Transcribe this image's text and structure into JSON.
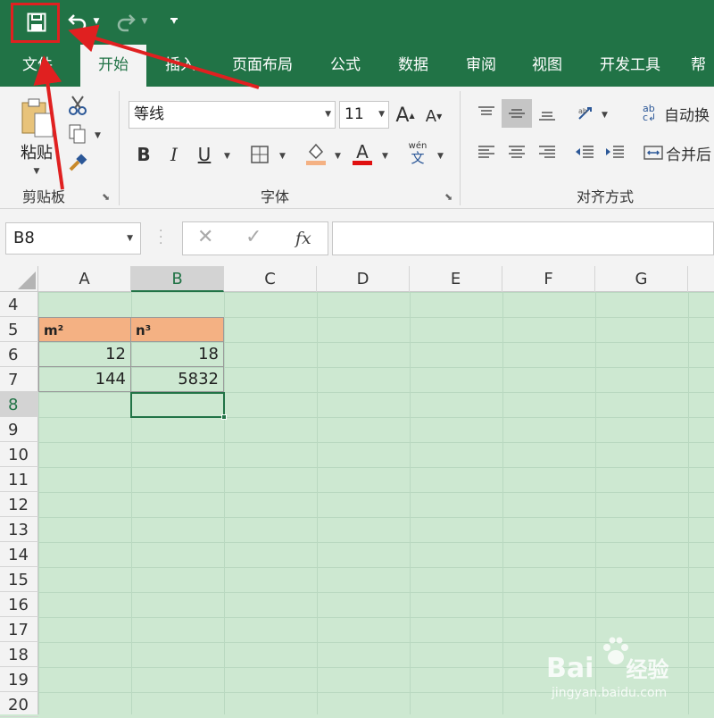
{
  "quick_access": {
    "save_icon": "save-icon",
    "undo_icon": "undo-icon",
    "redo_icon": "redo-icon",
    "customize_icon": "customize-qat-icon"
  },
  "tabs": [
    "文件",
    "开始",
    "插入",
    "页面布局",
    "公式",
    "数据",
    "审阅",
    "视图",
    "开发工具",
    "帮"
  ],
  "active_tab": "开始",
  "clipboard": {
    "paste_label": "粘贴",
    "group_label": "剪贴板"
  },
  "font": {
    "name": "等线",
    "size": "11",
    "group_label": "字体",
    "bold": "B",
    "italic": "I",
    "underline": "U",
    "phonetic_top": "wén",
    "phonetic_bottom": "文",
    "grow": "A",
    "shrink": "A",
    "font_color_letter": "A"
  },
  "alignment": {
    "wrap_text": "自动换",
    "merge_center": "合并后",
    "group_label": "对齐方式"
  },
  "formula_bar": {
    "name_box": "B8",
    "fx": "fx",
    "value": ""
  },
  "columns": [
    "A",
    "B",
    "C",
    "D",
    "E",
    "F",
    "G"
  ],
  "selected_column": "B",
  "rows": [
    "4",
    "5",
    "6",
    "7",
    "8",
    "9",
    "10",
    "11",
    "12",
    "13",
    "14",
    "15",
    "16",
    "17",
    "18",
    "19",
    "20"
  ],
  "selected_row": "8",
  "cells": {
    "A5": "m²",
    "B5": "n³",
    "A6": "12",
    "B6": "18",
    "A7": "144",
    "B7": "5832"
  },
  "colors": {
    "excel_green": "#217346",
    "header_fill": "#f4b183",
    "sheet_bg": "#cde8d1",
    "annotation_red": "#e02020"
  },
  "watermark": {
    "brand": "Bai",
    "brand_suffix": "经验",
    "url": "jingyan.baidu.com"
  }
}
